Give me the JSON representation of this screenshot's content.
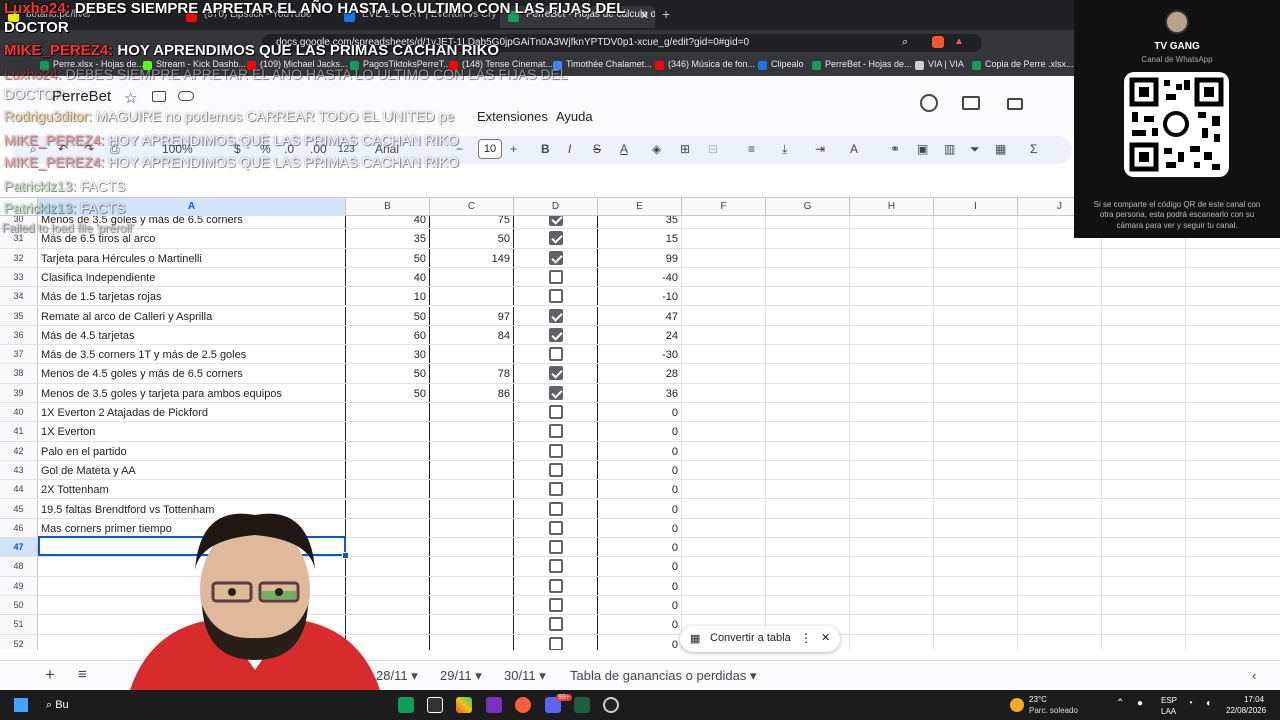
{
  "browser": {
    "tabs": [
      {
        "label": "betano.pe/live/",
        "color": "#e8f000"
      },
      {
        "label": "(570) Lipstick - YouTube",
        "color": "#ff0000"
      },
      {
        "label": "EVE 2-0 CRY | Everton vs Crystal Palace",
        "color": "#1a73e8"
      },
      {
        "label": "PerreBet - Hojas de cálculo de G",
        "color": "#0f9d58"
      }
    ],
    "url": "docs.google.com/spreadsheets/d/1vJET-1LDab5G0jpGAiTn0A3WjfknYPTDV0p1-xcue_g/edit?gid=0#gid=0",
    "bookmarks": [
      {
        "label": "Perre.xlsx - Hojas de...",
        "color": "#0f9d58"
      },
      {
        "label": "Stream - Kick Dashb...",
        "color": "#53fc18"
      },
      {
        "label": "(109) Michael Jacks...",
        "color": "#ff0000"
      },
      {
        "label": "PagosTiktoksPerreT...",
        "color": "#0f9d58"
      },
      {
        "label": "(148) Tense Cinemat...",
        "color": "#ff0000"
      },
      {
        "label": "Timothée Chalamet...",
        "color": "#4285f4"
      },
      {
        "label": "(346) Música de fon...",
        "color": "#ff0000"
      },
      {
        "label": "Clipealo",
        "color": "#1a73e8"
      },
      {
        "label": "PerreBet - Hojas de...",
        "color": "#0f9d58"
      },
      {
        "label": "VIA | VIA",
        "color": "#cccccc"
      },
      {
        "label": "Copia de Perre .xlsx...",
        "color": "#0f9d58"
      }
    ]
  },
  "sheets": {
    "title": "PerreBet",
    "menu": [
      "Extensiones",
      "Ayuda"
    ],
    "zoom": "100%",
    "currency": "$",
    "percent": "%",
    "dec_less": ".0",
    "dec_more": ".00",
    "format": "123",
    "font": "Arial",
    "font_size": "10",
    "columns": [
      "A",
      "B",
      "C",
      "D",
      "E",
      "F",
      "G",
      "H",
      "I",
      "J"
    ],
    "rows": [
      {
        "n": "30",
        "a": "Menos de 3.5 goles y más de 6.5 corners",
        "b": "40",
        "c": "75",
        "d": true,
        "e": "35"
      },
      {
        "n": "31",
        "a": "Más de 6.5 tiros al arco",
        "b": "35",
        "c": "50",
        "d": true,
        "e": "15"
      },
      {
        "n": "32",
        "a": "Tarjeta para Hércules o Martinelli",
        "b": "50",
        "c": "149",
        "d": true,
        "e": "99"
      },
      {
        "n": "33",
        "a": "Clasifica Independiente",
        "b": "40",
        "c": "",
        "d": false,
        "e": "-40"
      },
      {
        "n": "34",
        "a": "Más de 1.5 tarjetas rojas",
        "b": "10",
        "c": "",
        "d": false,
        "e": "-10"
      },
      {
        "n": "35",
        "a": "Remate al arco de Calleri y Asprilla",
        "b": "50",
        "c": "97",
        "d": true,
        "e": "47"
      },
      {
        "n": "36",
        "a": "Más de 4.5 tarjetas",
        "b": "60",
        "c": "84",
        "d": true,
        "e": "24"
      },
      {
        "n": "37",
        "a": "Más de 3.5 corners 1T y más de 2.5 goles",
        "b": "30",
        "c": "",
        "d": false,
        "e": "-30"
      },
      {
        "n": "38",
        "a": "Menos de 4.5 goles y más de 6.5 corners",
        "b": "50",
        "c": "78",
        "d": true,
        "e": "28"
      },
      {
        "n": "39",
        "a": "Menos de 3.5 goles y tarjeta para ambos equipos",
        "b": "50",
        "c": "86",
        "d": true,
        "e": "36"
      },
      {
        "n": "40",
        "a": "1X Everton 2 Atajadas de Pickford",
        "b": "",
        "c": "",
        "d": false,
        "e": "0"
      },
      {
        "n": "41",
        "a": "1X Everton",
        "b": "",
        "c": "",
        "d": false,
        "e": "0"
      },
      {
        "n": "42",
        "a": "Palo en el partido",
        "b": "",
        "c": "",
        "d": false,
        "e": "0"
      },
      {
        "n": "43",
        "a": "Gol de Mateta y AA",
        "b": "",
        "c": "",
        "d": false,
        "e": "0"
      },
      {
        "n": "44",
        "a": "2X Tottenham",
        "b": "",
        "c": "",
        "d": false,
        "e": "0"
      },
      {
        "n": "45",
        "a": "19.5 faltas Brendtford vs Tottenham",
        "b": "",
        "c": "",
        "d": false,
        "e": "0"
      },
      {
        "n": "46",
        "a": "Mas corners primer tiempo",
        "b": "",
        "c": "",
        "d": false,
        "e": "0"
      },
      {
        "n": "47",
        "a": "",
        "b": "",
        "c": "",
        "d": false,
        "e": "0"
      },
      {
        "n": "48",
        "a": "",
        "b": "",
        "c": "",
        "d": false,
        "e": "0"
      },
      {
        "n": "49",
        "a": "",
        "b": "",
        "c": "",
        "d": false,
        "e": "0"
      },
      {
        "n": "50",
        "a": "",
        "b": "",
        "c": "",
        "d": false,
        "e": "0"
      },
      {
        "n": "51",
        "a": "",
        "b": "",
        "c": "",
        "d": false,
        "e": "0"
      },
      {
        "n": "52",
        "a": "",
        "b": "",
        "c": "",
        "d": false,
        "e": "0"
      }
    ],
    "convert_label": "Convertir a tabla",
    "sheet_tabs": [
      "28/11",
      "29/11",
      "30/11",
      "Tabla de ganancias o perdidas"
    ]
  },
  "chat": [
    {
      "user": "Luxho24:",
      "msg": "DEBES SIEMPRE APRETAR EL AÑO HASTA LO ULTIMO CON LAS FIJAS DEL"
    },
    {
      "user": "",
      "msg": "DOCTOR"
    },
    {
      "user": "MIKE_PEREZ4:",
      "msg": "HOY APRENDIMOS QUE LAS PRIMAS CACHAN RIKO"
    },
    {
      "user": "Luxho24:",
      "msg": "DEBES SIEMPRE APRETAR EL AÑO HASTA LO ULTIMO CON LAS FIJAS DEL"
    },
    {
      "user": "",
      "msg": "DOCTOR"
    },
    {
      "user": "Rodrigu3ditor:",
      "msg": "MAGUIRE no podemos CARREAR TODO EL UNITED pe"
    },
    {
      "user": "MIKE_PEREZ4:",
      "msg": "HOY APRENDIMOS QUE LAS PRIMAS CACHAN RIKO"
    },
    {
      "user": "MIKE_PEREZ4:",
      "msg": "HOY APRENDIMOS QUE LAS PRIMAS CACHAN RIKO"
    },
    {
      "user": "Patricklz13:",
      "msg": "FACTS"
    },
    {
      "user": "Patricklz13:",
      "msg": "FACTS"
    },
    {
      "user": "",
      "msg": "Failed to load file 'preroll'"
    }
  ],
  "whatsapp": {
    "title": "TV GANG",
    "subtitle": "Canal de WhatsApp",
    "description": "Si se comparte el código QR de este canal con otra persona, esta podrá escanearlo con su cámara para ver y seguir tu canal."
  },
  "taskbar": {
    "search": "Bu",
    "weather_temp": "23°C",
    "weather_desc": "Parc. soleado",
    "lang": "ESP",
    "lang2": "LAA",
    "time": "17:04",
    "date": "22/08/2026",
    "badge": "99+"
  }
}
